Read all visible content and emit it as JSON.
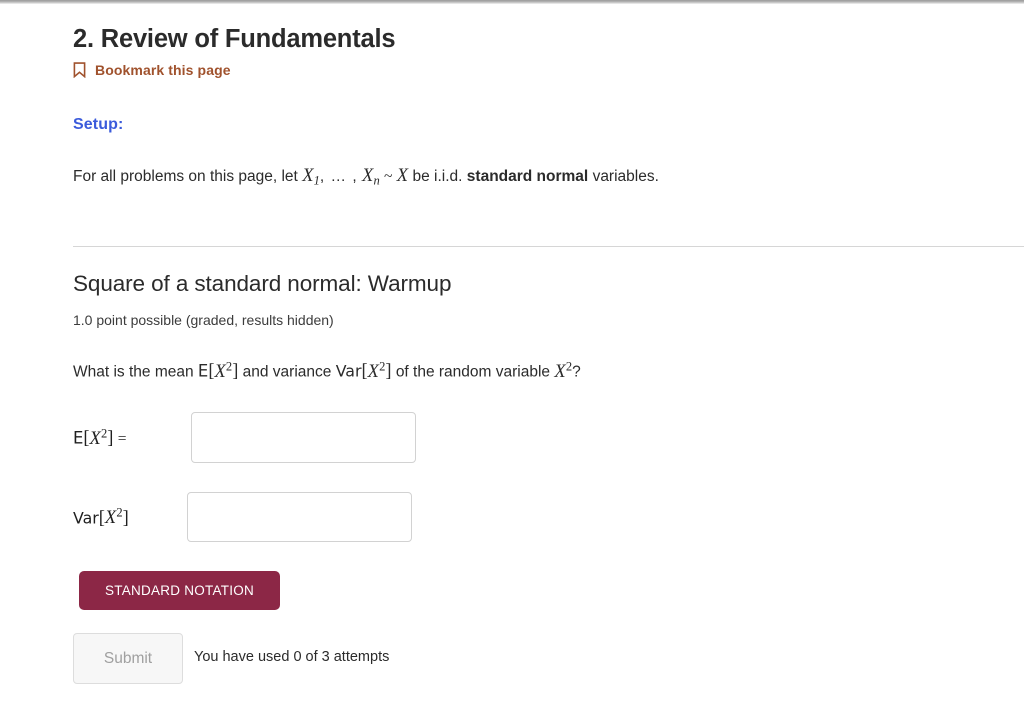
{
  "header": {
    "unit_title": "2. Review of Fundamentals",
    "bookmark_label": "Bookmark this page",
    "bookmark_icon": "bookmark-icon",
    "bookmark_color": "#a0522d"
  },
  "setup": {
    "heading": "Setup:",
    "heading_color": "#3b5bdb",
    "text_before": "For all problems on this page, let",
    "var_first": "X",
    "var_first_sub": "1",
    "ellipsis": ", … ,",
    "var_last": "X",
    "var_last_sub": "n",
    "tilde": "~",
    "var_dist": "X",
    "text_middle": "be i.i.d.",
    "text_bold": "standard normal",
    "text_after": "variables."
  },
  "problem": {
    "title": "Square of a standard normal: Warmup",
    "meta": "1.0 point possible (graded, results hidden)",
    "question": {
      "part1": "What is the mean",
      "expectation_symbol": "ᴇ",
      "expectation_bb": "E",
      "bracket_open": "[",
      "variable": "X",
      "exponent": "2",
      "bracket_close": "]",
      "part2": "and variance",
      "variance_symbol": "Var",
      "part3": "of the random variable",
      "part4": "?"
    },
    "answers": [
      {
        "label_symbol": "E",
        "label_variable": "X",
        "label_exponent": "2",
        "label_equals": "=",
        "value": "",
        "placeholder": ""
      },
      {
        "label_symbol": "Var",
        "label_variable": "X",
        "label_exponent": "2",
        "label_equals": "",
        "value": "",
        "placeholder": ""
      }
    ],
    "notation_button": "STANDARD NOTATION",
    "notation_button_color": "#8c2746",
    "submit_button": "Submit",
    "attempts_text": "You have used 0 of 3 attempts"
  }
}
